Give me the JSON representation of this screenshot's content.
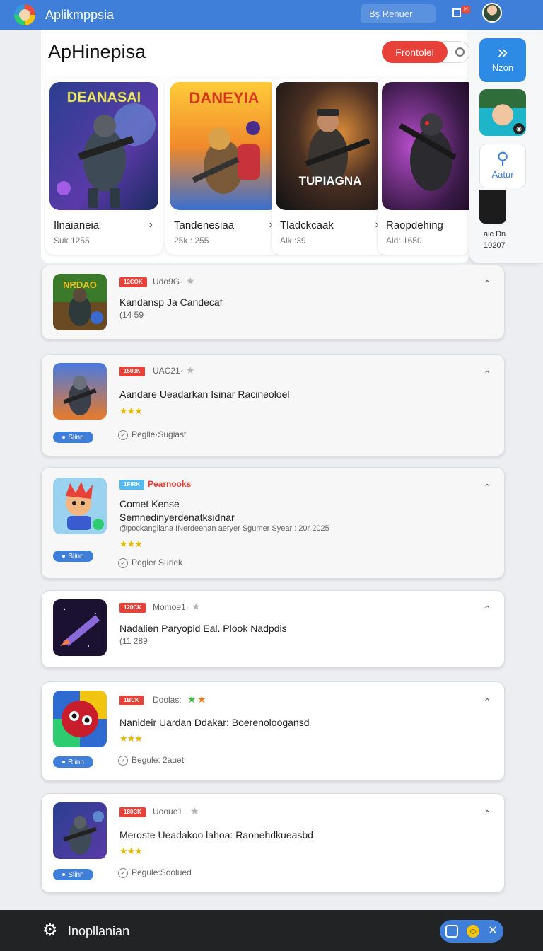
{
  "header": {
    "app_name": "Aplikmppsia",
    "search_label": "Bş Renuer",
    "notif_badge": "H"
  },
  "main": {
    "title": "ApHinepisa",
    "toggle_label": "Frontolei"
  },
  "featured": [
    {
      "art_text": "DEANASAI",
      "name": "Ilnaianeia",
      "meta": "Suk 1255"
    },
    {
      "art_text": "DANEYIA",
      "name": "Tandenesiaa",
      "meta": "25k : 255"
    },
    {
      "art_text": "TUPIAGNA",
      "name": "Tladckcaak",
      "meta": "Alk :39"
    },
    {
      "art_text": "",
      "name": "Raopdehing",
      "meta": "Ald: 1650"
    }
  ],
  "side": {
    "nav_label": "Nzon",
    "action_label": "Aatur",
    "partial_text_1": "alc Dn",
    "partial_text_2": "10207"
  },
  "list": [
    {
      "thumb_text": "NRDAO",
      "tag": "12COK",
      "tag_text": "Udo9G·",
      "title": "Kandansp Ja Candecaf",
      "sub": "(14 59",
      "stars": "",
      "pill": "",
      "check": ""
    },
    {
      "thumb_text": "",
      "tag": "1500K",
      "tag_text": "UAC21·",
      "title": "Aandare Ueadarkan Isinar Racineoloel",
      "sub": "",
      "stars": "★★★",
      "pill": "Slinn",
      "check": "Peglle·Suglast"
    },
    {
      "thumb_text": "",
      "tag": "1FIRK",
      "tag_text": "Pearnooks",
      "title": "Comet Kense",
      "title2": "Semnedinyerdenatksidnar",
      "sub": "@pockangliana INerdeenan aeryer Sgumer Syear : 20r 2025",
      "stars": "★★★",
      "pill": "Slinn",
      "check": "Pegler Surlek"
    },
    {
      "thumb_text": "",
      "tag": "120CK",
      "tag_text": "Momoe1·",
      "title": "Nadalien Paryopid Eal. Plook Nadpdis",
      "sub": "(11 289",
      "stars": "",
      "pill": "",
      "check": ""
    },
    {
      "thumb_text": "",
      "tag": "1BCK",
      "tag_text": "Doolas:",
      "title": "Nanideir Uardan Ddakar: Boerenoloogansd",
      "sub": "",
      "stars": "★★★",
      "pill": "Rlinn",
      "check": "Begule: 2auetl"
    },
    {
      "thumb_text": "",
      "tag": "180CK",
      "tag_text": "Uooue1",
      "title": "Meroste Ueadakoo lahoa: Raonehdkueasbd",
      "sub": "",
      "stars": "★★★",
      "pill": "Slinn",
      "check": "Pegule:Soolued"
    }
  ],
  "footer": {
    "label": "Inopllanian"
  },
  "colors": {
    "header_blue": "#3f7fd9",
    "accent_red": "#e8413a",
    "star_gold": "#e6b800",
    "bottom_bar": "#222325"
  }
}
